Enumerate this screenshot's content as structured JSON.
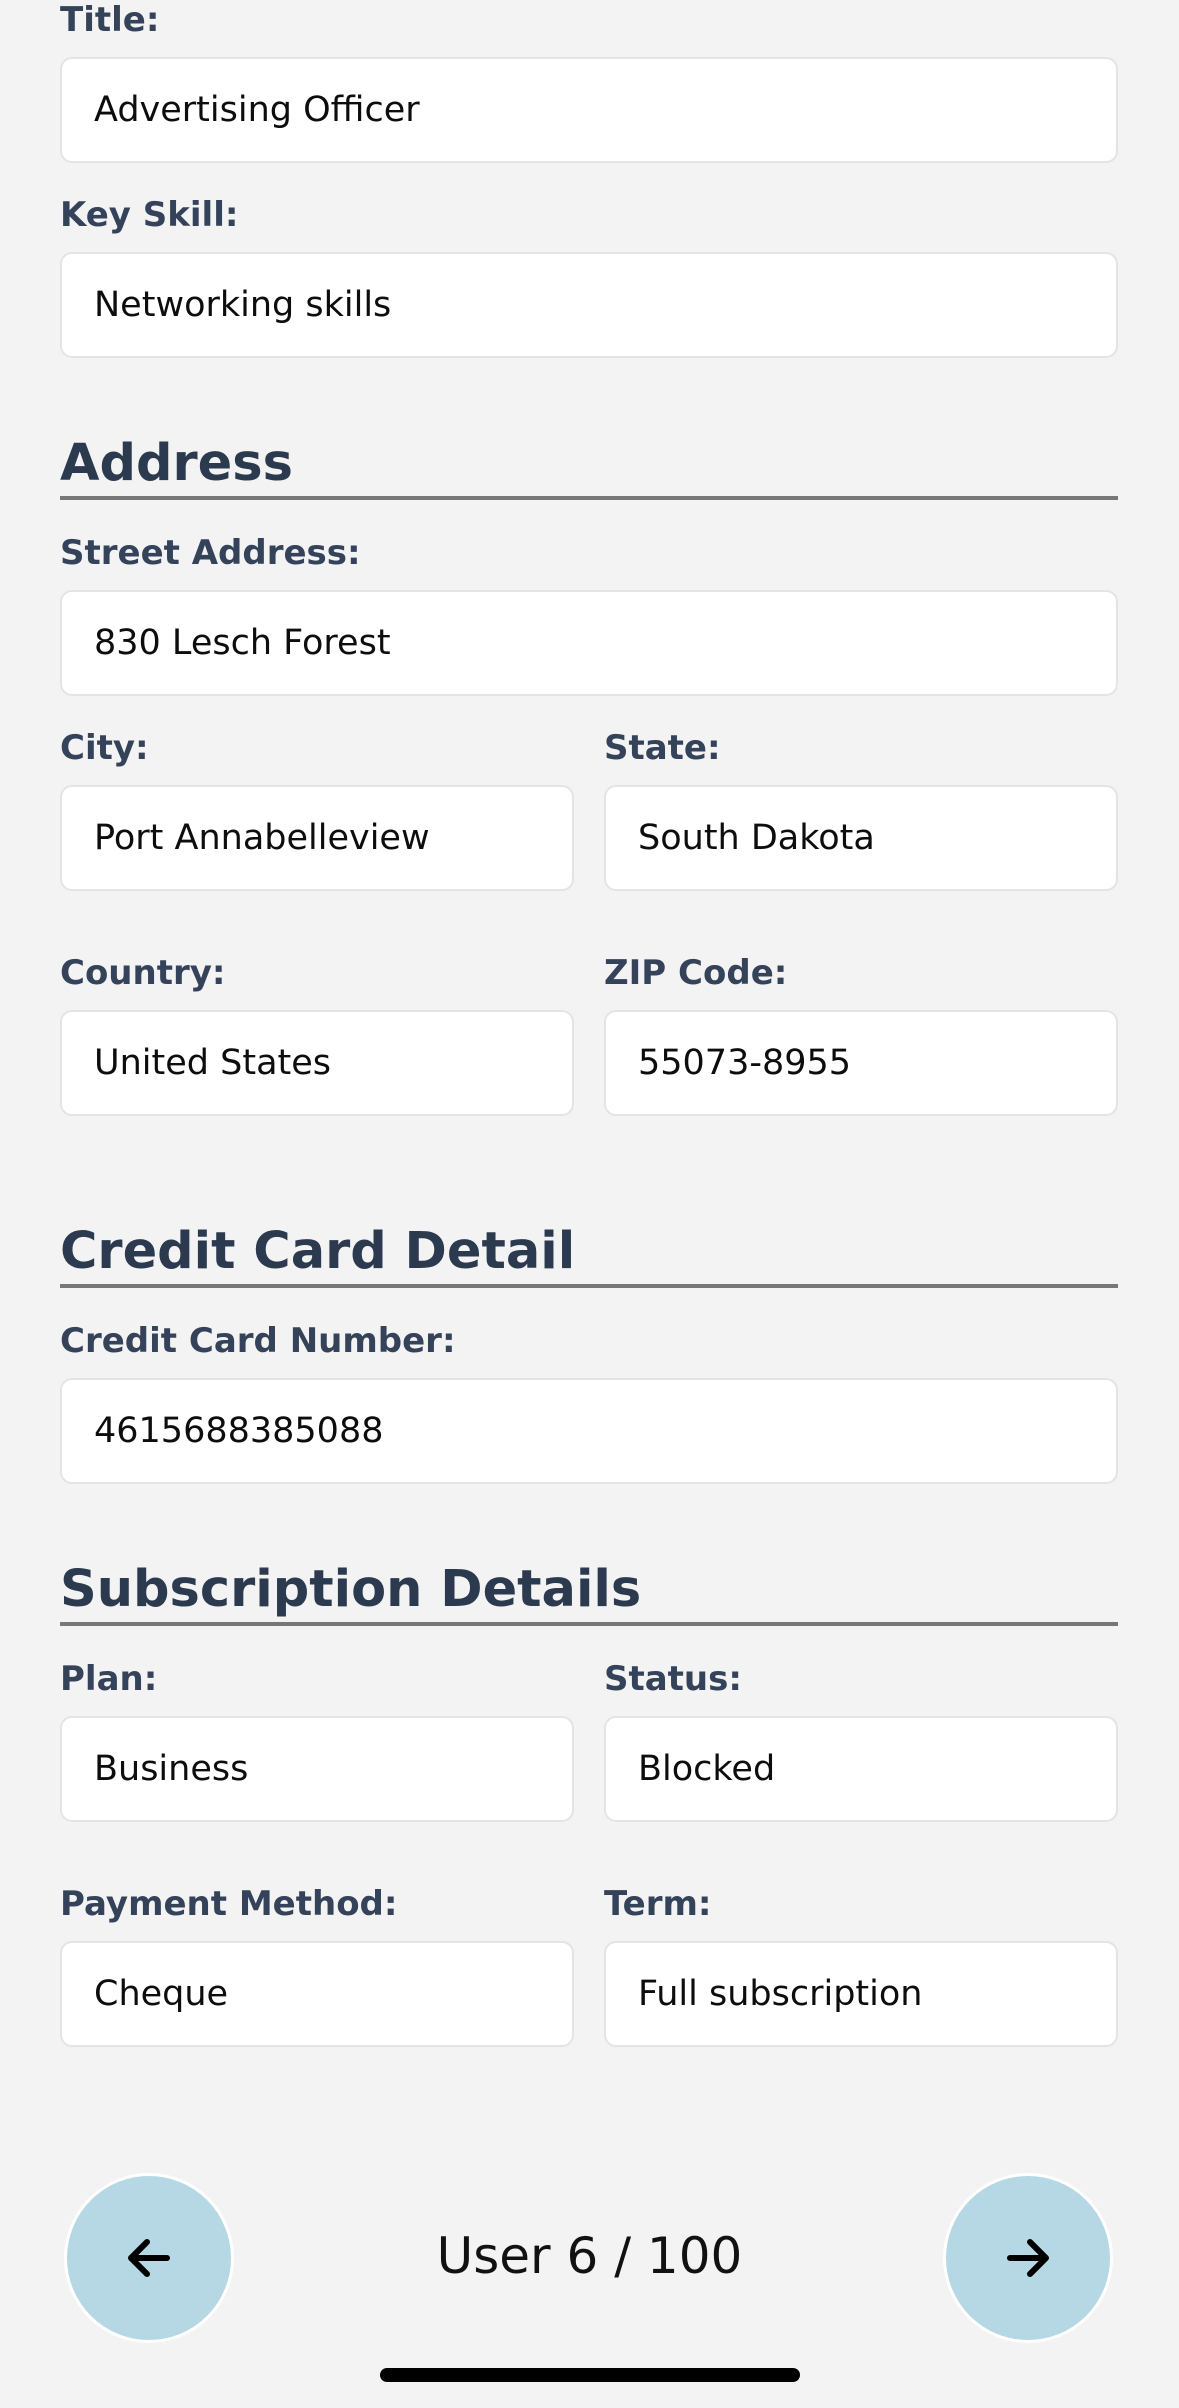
{
  "personal": {
    "title_label": "Title:",
    "title_value": "Advertising Officer",
    "key_skill_label": "Key Skill:",
    "key_skill_value": "Networking skills"
  },
  "address": {
    "heading": "Address",
    "street_label": "Street Address:",
    "street_value": "830 Lesch Forest",
    "city_label": "City:",
    "city_value": "Port Annabelleview",
    "state_label": "State:",
    "state_value": "South Dakota",
    "country_label": "Country:",
    "country_value": "United States",
    "zip_label": "ZIP Code:",
    "zip_value": "55073-8955"
  },
  "credit_card": {
    "heading": "Credit Card Detail",
    "number_label": "Credit Card Number:",
    "number_value": "4615688385088"
  },
  "subscription": {
    "heading": "Subscription Details",
    "plan_label": "Plan:",
    "plan_value": "Business",
    "status_label": "Status:",
    "status_value": "Blocked",
    "payment_label": "Payment Method:",
    "payment_value": "Cheque",
    "term_label": "Term:",
    "term_value": "Full subscription"
  },
  "navigation": {
    "counter": "User 6 / 100",
    "prev_icon": "arrow-left-icon",
    "next_icon": "arrow-right-icon",
    "button_color": "#b5d8e4"
  }
}
